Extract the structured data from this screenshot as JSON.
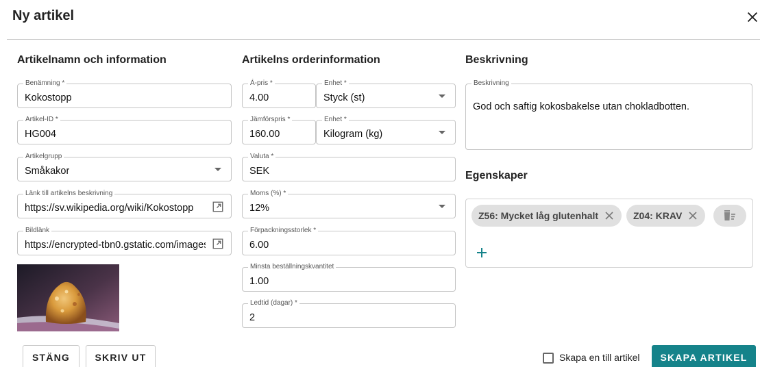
{
  "dialog": {
    "title": "Ny artikel"
  },
  "sections": {
    "info": "Artikelnamn och information",
    "order": "Artikelns orderinformation",
    "description": "Beskrivning",
    "properties": "Egenskaper"
  },
  "info": {
    "name": {
      "label": "Benämning *",
      "value": "Kokostopp"
    },
    "article_id": {
      "label": "Artikel-ID *",
      "value": "HG004"
    },
    "group": {
      "label": "Artikelgrupp",
      "value": "Småkakor"
    },
    "desc_link": {
      "label": "Länk till artikelns beskrivning",
      "value": "https://sv.wikipedia.org/wiki/Kokostopp"
    },
    "image_link": {
      "label": "Bildlänk",
      "value": "https://encrypted-tbn0.gstatic.com/images"
    }
  },
  "order": {
    "unit_price": {
      "label": "Á-pris *",
      "value": "4.00"
    },
    "unit": {
      "label": "Enhet *",
      "value": "Styck (st)"
    },
    "compare_price": {
      "label": "Jämförspris *",
      "value": "160.00"
    },
    "compare_unit": {
      "label": "Enhet *",
      "value": "Kilogram (kg)"
    },
    "currency": {
      "label": "Valuta *",
      "value": "SEK"
    },
    "vat": {
      "label": "Moms (%) *",
      "value": "12%"
    },
    "package_size": {
      "label": "Förpackningsstorlek *",
      "value": "6.00"
    },
    "min_order": {
      "label": "Minsta beställningskvantitet",
      "value": "1.00"
    },
    "lead_time": {
      "label": "Ledtid (dagar) *",
      "value": "2"
    }
  },
  "description": {
    "label": "Beskrivning",
    "value": "God och saftig kokosbakelse utan chokladbotten."
  },
  "properties": {
    "chips": [
      "Z56: Mycket låg glutenhalt",
      "Z04: KRAV"
    ]
  },
  "footer": {
    "close_label": "STÄNG",
    "print_label": "SKRIV UT",
    "create_another_label": "Skapa en till artikel",
    "create_label": "SKAPA ARTIKEL"
  },
  "colors": {
    "primary": "#15838a",
    "chip_bg": "#e0e0e0",
    "border": "#c4c4c4"
  },
  "icons": {
    "close": "close-icon",
    "dropdown": "chevron-down-icon",
    "external": "external-link-icon",
    "chip_remove": "close-icon",
    "delete_all": "delete-sweep-icon",
    "add": "plus-icon"
  }
}
